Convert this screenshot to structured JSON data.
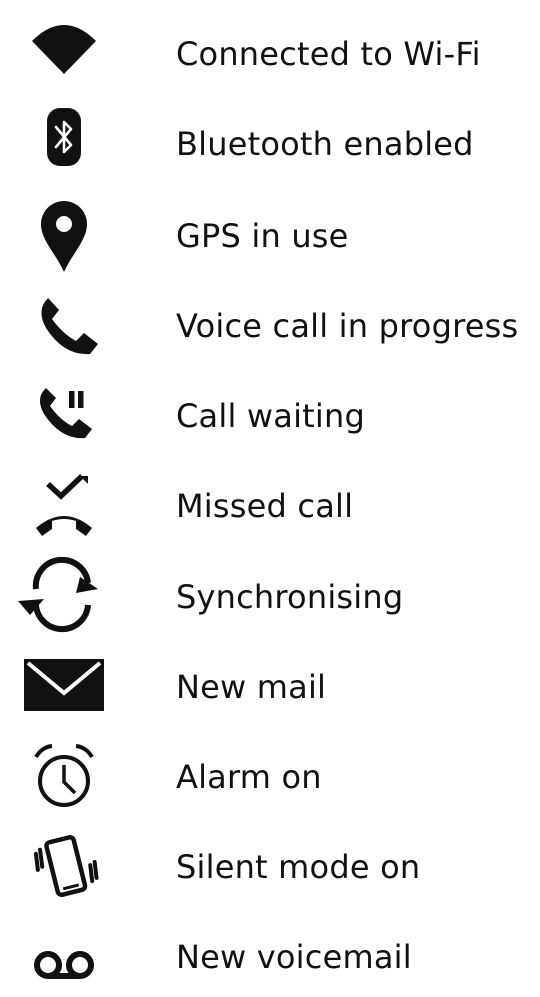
{
  "theme": {
    "ink": "#111111",
    "background": "#ffffff"
  },
  "items": [
    {
      "icon": "wifi-icon",
      "label": "Connected to Wi-Fi"
    },
    {
      "icon": "bluetooth-icon",
      "label": "Bluetooth enabled"
    },
    {
      "icon": "location-pin-icon",
      "label": "GPS in use"
    },
    {
      "icon": "phone-call-icon",
      "label": "Voice call in progress"
    },
    {
      "icon": "call-waiting-icon",
      "label": "Call waiting"
    },
    {
      "icon": "missed-call-icon",
      "label": "Missed call"
    },
    {
      "icon": "sync-icon",
      "label": "Synchronising"
    },
    {
      "icon": "mail-icon",
      "label": "New mail"
    },
    {
      "icon": "alarm-clock-icon",
      "label": "Alarm on"
    },
    {
      "icon": "vibrate-icon",
      "label": "Silent mode on"
    },
    {
      "icon": "voicemail-icon",
      "label": "New voicemail"
    }
  ]
}
